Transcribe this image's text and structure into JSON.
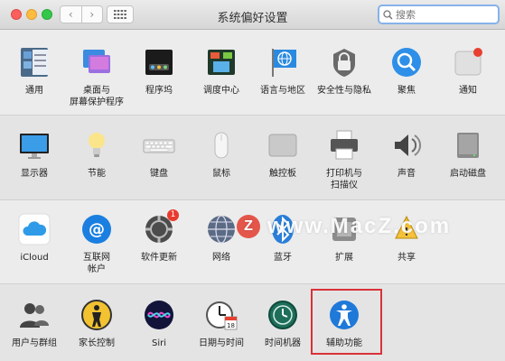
{
  "window": {
    "title": "系统偏好设置",
    "search_placeholder": "搜索"
  },
  "rows": [
    [
      {
        "label": "通用",
        "icon": "general-icon"
      },
      {
        "label": "桌面与\n屏幕保护程序",
        "icon": "desktop-screensaver-icon"
      },
      {
        "label": "程序坞",
        "icon": "dock-icon"
      },
      {
        "label": "调度中心",
        "icon": "mission-control-icon"
      },
      {
        "label": "语言与地区",
        "icon": "language-region-icon"
      },
      {
        "label": "安全性与隐私",
        "icon": "security-privacy-icon"
      },
      {
        "label": "聚焦",
        "icon": "spotlight-icon"
      },
      {
        "label": "通知",
        "icon": "notifications-icon"
      }
    ],
    [
      {
        "label": "显示器",
        "icon": "displays-icon"
      },
      {
        "label": "节能",
        "icon": "energy-saver-icon"
      },
      {
        "label": "键盘",
        "icon": "keyboard-icon"
      },
      {
        "label": "鼠标",
        "icon": "mouse-icon"
      },
      {
        "label": "触控板",
        "icon": "trackpad-icon"
      },
      {
        "label": "打印机与\n扫描仪",
        "icon": "printers-scanners-icon"
      },
      {
        "label": "声音",
        "icon": "sound-icon"
      },
      {
        "label": "启动磁盘",
        "icon": "startup-disk-icon"
      }
    ],
    [
      {
        "label": "iCloud",
        "icon": "icloud-icon"
      },
      {
        "label": "互联网\n帐户",
        "icon": "internet-accounts-icon"
      },
      {
        "label": "软件更新",
        "icon": "software-update-icon",
        "badge": "1"
      },
      {
        "label": "网络",
        "icon": "network-icon"
      },
      {
        "label": "蓝牙",
        "icon": "bluetooth-icon"
      },
      {
        "label": "扩展",
        "icon": "extensions-icon"
      },
      {
        "label": "共享",
        "icon": "sharing-icon"
      }
    ],
    [
      {
        "label": "用户与群组",
        "icon": "users-groups-icon"
      },
      {
        "label": "家长控制",
        "icon": "parental-controls-icon"
      },
      {
        "label": "Siri",
        "icon": "siri-icon"
      },
      {
        "label": "日期与时间",
        "icon": "date-time-icon"
      },
      {
        "label": "时间机器",
        "icon": "time-machine-icon"
      },
      {
        "label": "辅助功能",
        "icon": "accessibility-icon"
      }
    ]
  ],
  "watermark": {
    "logo_letter": "Z",
    "text": "www.MacZ.com"
  }
}
